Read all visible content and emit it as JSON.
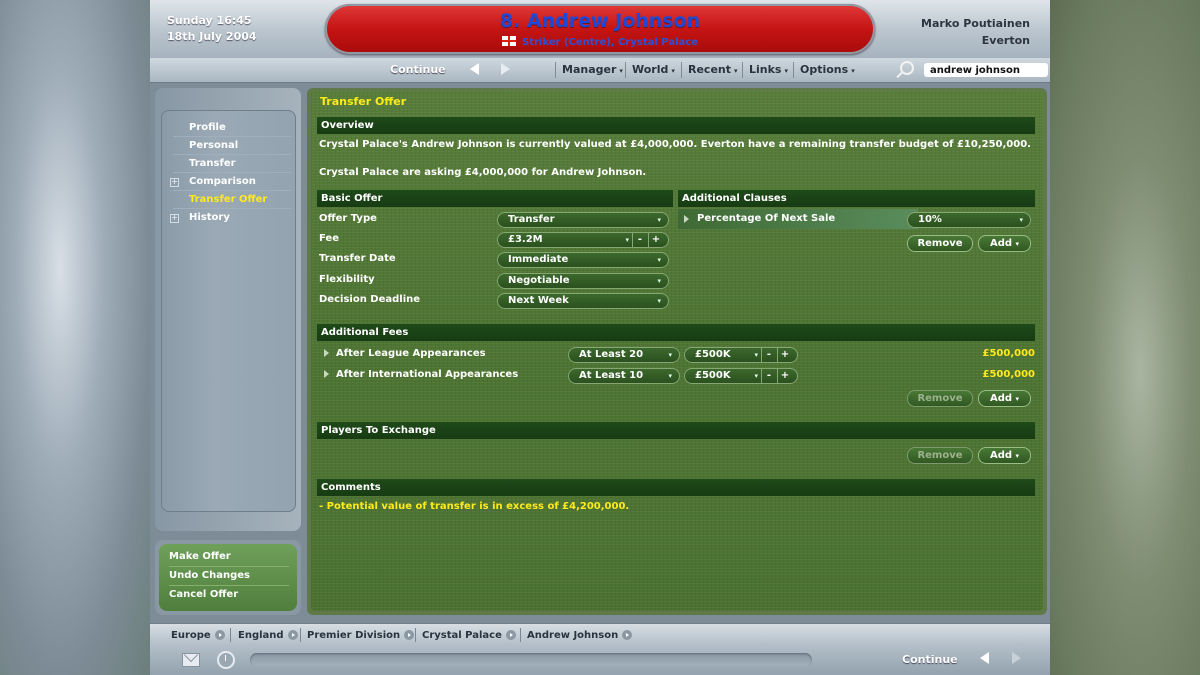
{
  "header": {
    "day_time": "Sunday 16:45",
    "date": "18th July 2004",
    "player_name": "8. Andrew Johnson",
    "player_role": "Striker (Centre), Crystal Palace",
    "manager": "Marko Poutiainen",
    "club": "Everton"
  },
  "toolbar": {
    "continue": "Continue",
    "menus": [
      "Manager",
      "World",
      "Recent",
      "Links",
      "Options"
    ],
    "search_value": "andrew johnson"
  },
  "nav": {
    "items": [
      "Profile",
      "Personal",
      "Transfer",
      "Comparison",
      "Transfer Offer",
      "History"
    ],
    "active": "Transfer Offer",
    "actions": [
      "Make Offer",
      "Undo Changes",
      "Cancel Offer"
    ]
  },
  "page": {
    "title": "Transfer Offer",
    "overview": {
      "header": "Overview",
      "line1": "Crystal Palace's Andrew Johnson is currently valued at £4,000,000. Everton have a remaining transfer budget of £10,250,000.",
      "line2": "Crystal Palace are asking £4,000,000 for Andrew Johnson."
    },
    "basic_offer": {
      "header": "Basic Offer",
      "offer_type_label": "Offer Type",
      "offer_type": "Transfer",
      "fee_label": "Fee",
      "fee": "£3.2M",
      "transfer_date_label": "Transfer Date",
      "transfer_date": "Immediate",
      "flexibility_label": "Flexibility",
      "flexibility": "Negotiable",
      "deadline_label": "Decision Deadline",
      "deadline": "Next Week"
    },
    "clauses": {
      "header": "Additional Clauses",
      "item_label": "Percentage Of Next Sale",
      "item_value": "10%",
      "remove": "Remove",
      "add": "Add"
    },
    "fees": {
      "header": "Additional Fees",
      "rows": [
        {
          "label": "After League Appearances",
          "condition": "At Least 20",
          "amount": "£500K",
          "total": "£500,000"
        },
        {
          "label": "After International Appearances",
          "condition": "At Least 10",
          "amount": "£500K",
          "total": "£500,000"
        }
      ],
      "remove": "Remove",
      "add": "Add"
    },
    "exchange": {
      "header": "Players To Exchange",
      "remove": "Remove",
      "add": "Add"
    },
    "comments": {
      "header": "Comments",
      "text": "- Potential value of transfer is in excess of £4,200,000."
    }
  },
  "breadcrumb": [
    "Europe",
    "England",
    "Premier Division",
    "Crystal Palace",
    "Andrew Johnson"
  ],
  "status": {
    "continue": "Continue"
  }
}
